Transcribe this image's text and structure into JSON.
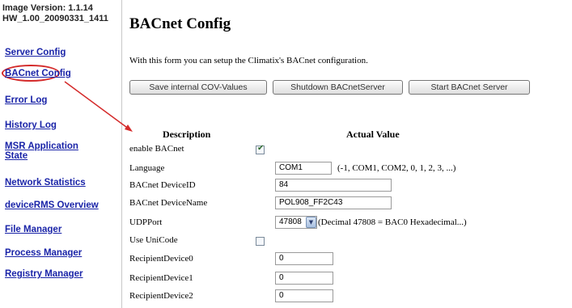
{
  "sidebar": {
    "version_line1": "Image Version: 1.1.14",
    "version_line2": "HW_1.00_20090331_1411",
    "items": [
      {
        "label": "Server Config"
      },
      {
        "label": "BACnet Config"
      },
      {
        "label": "Error Log"
      },
      {
        "label": "History Log"
      },
      {
        "label": "MSR Application State"
      },
      {
        "label": "Network Statistics"
      },
      {
        "label": "deviceRMS Overview"
      },
      {
        "label": "File Manager"
      },
      {
        "label": "Process Manager"
      },
      {
        "label": "Registry Manager"
      }
    ]
  },
  "main": {
    "title": "BACnet Config",
    "intro": "With this form you can setup the Climatix's BACnet configuration.",
    "buttons": {
      "save": "Save internal COV-Values",
      "shutdown": "Shutdown BACnetServer",
      "start": "Start BACnet Server"
    },
    "columns": {
      "description": "Description",
      "value": "Actual Value"
    },
    "rows": {
      "enable_label": "enable BACnet",
      "enable_checked": true,
      "language_label": "Language",
      "language_value": "COM1",
      "language_hint": "(-1, COM1, COM2, 0, 1, 2, 3, ...)",
      "device_id_label": "BACnet DeviceID",
      "device_id_value": "84",
      "device_name_label": "BACnet DeviceName",
      "device_name_value": "POL908_FF2C43",
      "udp_label": "UDPPort",
      "udp_value": "47808",
      "udp_hint": "(Decimal 47808 = BAC0 Hexadecimal...)",
      "unicode_label": "Use UniCode",
      "unicode_checked": false,
      "recipient0_label": "RecipientDevice0",
      "recipient0_value": "0",
      "recipient1_label": "RecipientDevice1",
      "recipient1_value": "0",
      "recipient2_label": "RecipientDevice2",
      "recipient2_value": "0"
    }
  },
  "colors": {
    "link": "#1a24a8",
    "highlight": "#d42a2a"
  }
}
